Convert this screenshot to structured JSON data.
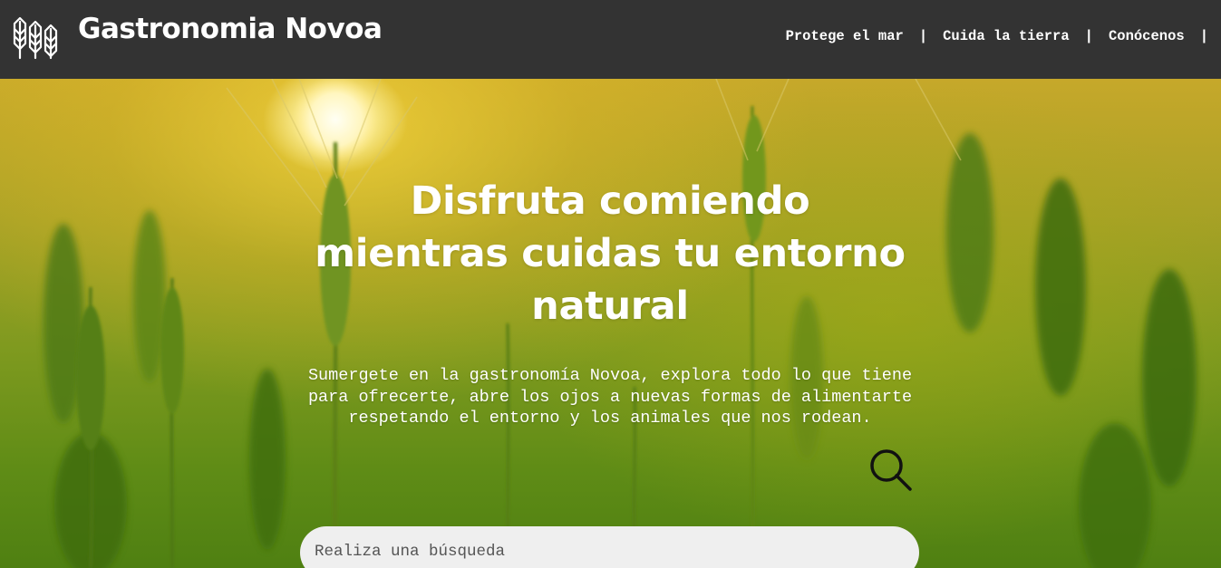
{
  "header": {
    "brand": "Gastronomia Novoa",
    "logo_icon": "wheat-icon",
    "nav": [
      {
        "label": "Protege el mar"
      },
      {
        "label": "Cuida la tierra"
      },
      {
        "label": "Conócenos"
      }
    ],
    "separator": "|"
  },
  "hero": {
    "headline_lines": [
      "Disfruta comiendo",
      "mientras cuidas tu entorno",
      "natural"
    ],
    "subtext": "Sumergete en la gastronomía Novoa, explora todo lo que tiene para ofrecerte, abre los ojos a nuevas formas de alimentarte respetando el entorno y los animales que nos rodean."
  },
  "search": {
    "placeholder": "Realiza una búsqueda",
    "value": "",
    "icon": "search-icon"
  },
  "colors": {
    "header_bg": "#333333",
    "text": "#ffffff",
    "search_bg": "#efefef"
  }
}
